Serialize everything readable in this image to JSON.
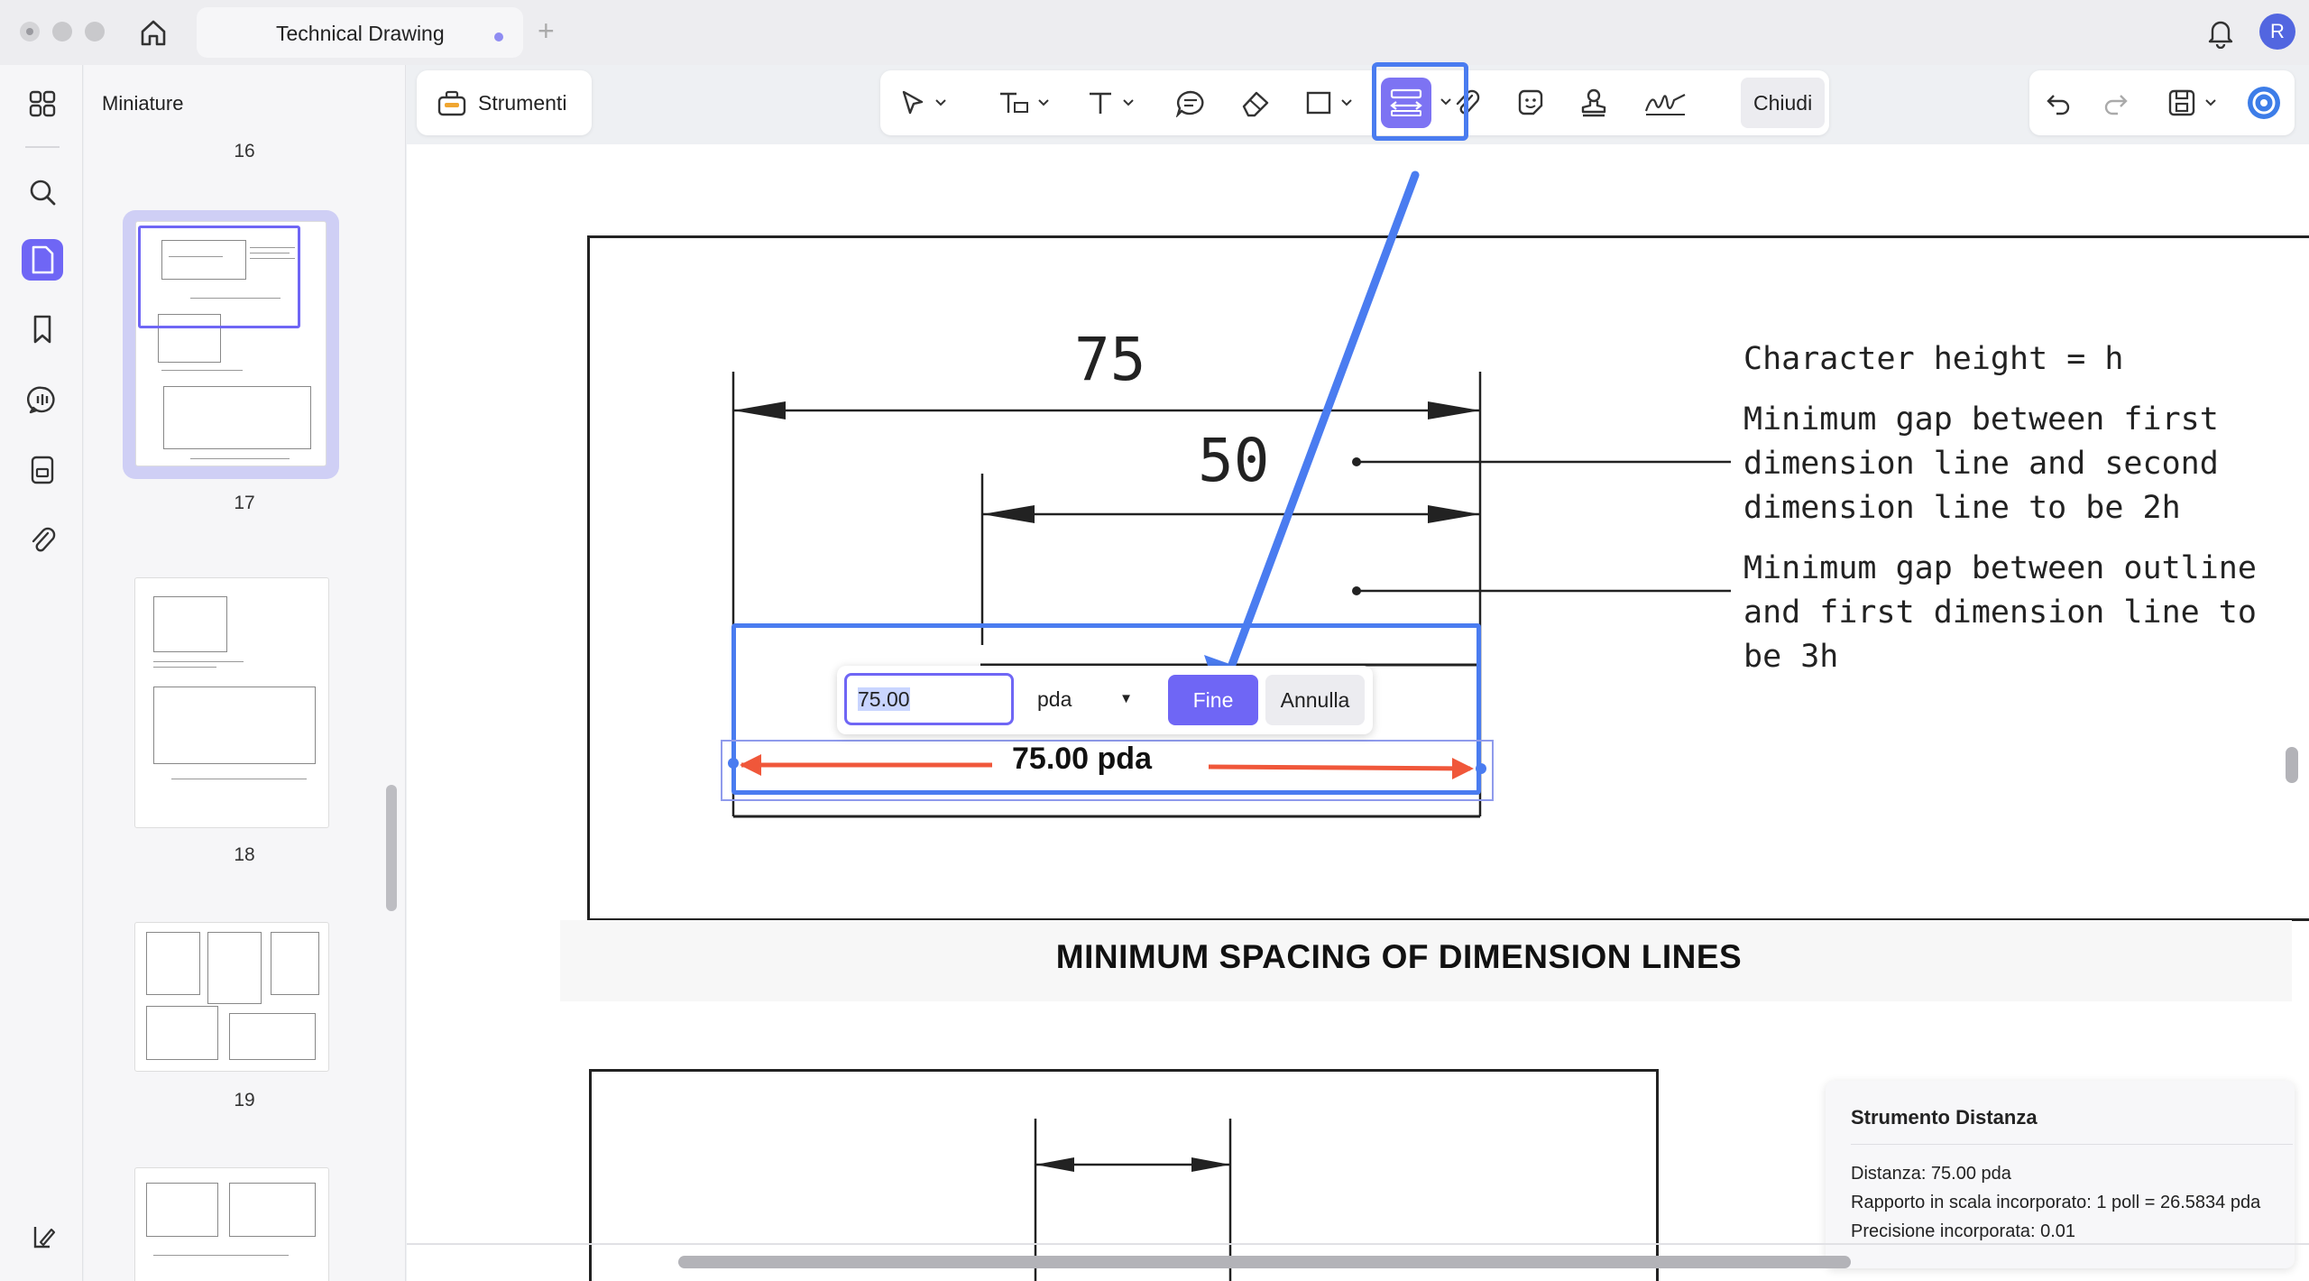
{
  "window": {
    "tab_title": "Technical Drawing",
    "new_tab": "+",
    "user_initial": "R",
    "icons": [
      "home-icon",
      "bell-icon"
    ]
  },
  "rail": {
    "items": [
      "grid-icon",
      "search-icon",
      "page-icon",
      "bookmark-icon",
      "comment-icon",
      "form-icon",
      "attachment-icon"
    ],
    "bottom": "sidebar-toggle-icon"
  },
  "thumbnails": {
    "title": "Miniature",
    "pages": [
      "16",
      "17",
      "18",
      "19"
    ],
    "current": "17"
  },
  "toolbar": {
    "strumenti_label": "Strumenti",
    "tools": [
      "select-icon",
      "text-box-icon",
      "text-icon",
      "comment-bubble-icon",
      "eraser-icon",
      "shape-icon",
      "measure-icon",
      "attachment-icon",
      "sticker-icon",
      "stamp-icon",
      "signature-icon"
    ],
    "close_label": "Chiudi",
    "right_tools": [
      "undo-icon",
      "redo-icon",
      "save-icon",
      "ai-assistant-icon"
    ]
  },
  "drawing": {
    "dim_outer": "75",
    "dim_inner": "50",
    "note1": "Character height = h",
    "note2": "Minimum gap between first\ndimension line and second\ndimension line to be 2h",
    "note3": "Minimum gap between outline\nand first dimension line to\nbe 3h",
    "caption": "MINIMUM SPACING OF DIMENSION LINES"
  },
  "measurement": {
    "input_value": "75.00",
    "unit": "pda",
    "ok_label": "Fine",
    "cancel_label": "Annulla",
    "label": "75.00 pda"
  },
  "info_panel": {
    "title": "Strumento Distanza",
    "distance": "Distanza: 75.00 pda",
    "scale": "Rapporto in scala incorporato: 1 poll = 26.5834 pda",
    "precision": "Precisione incorporata: 0.01"
  },
  "colors": {
    "accent": "#6f66f5",
    "highlight": "#4a7cf0",
    "measure_line": "#f0573a"
  }
}
